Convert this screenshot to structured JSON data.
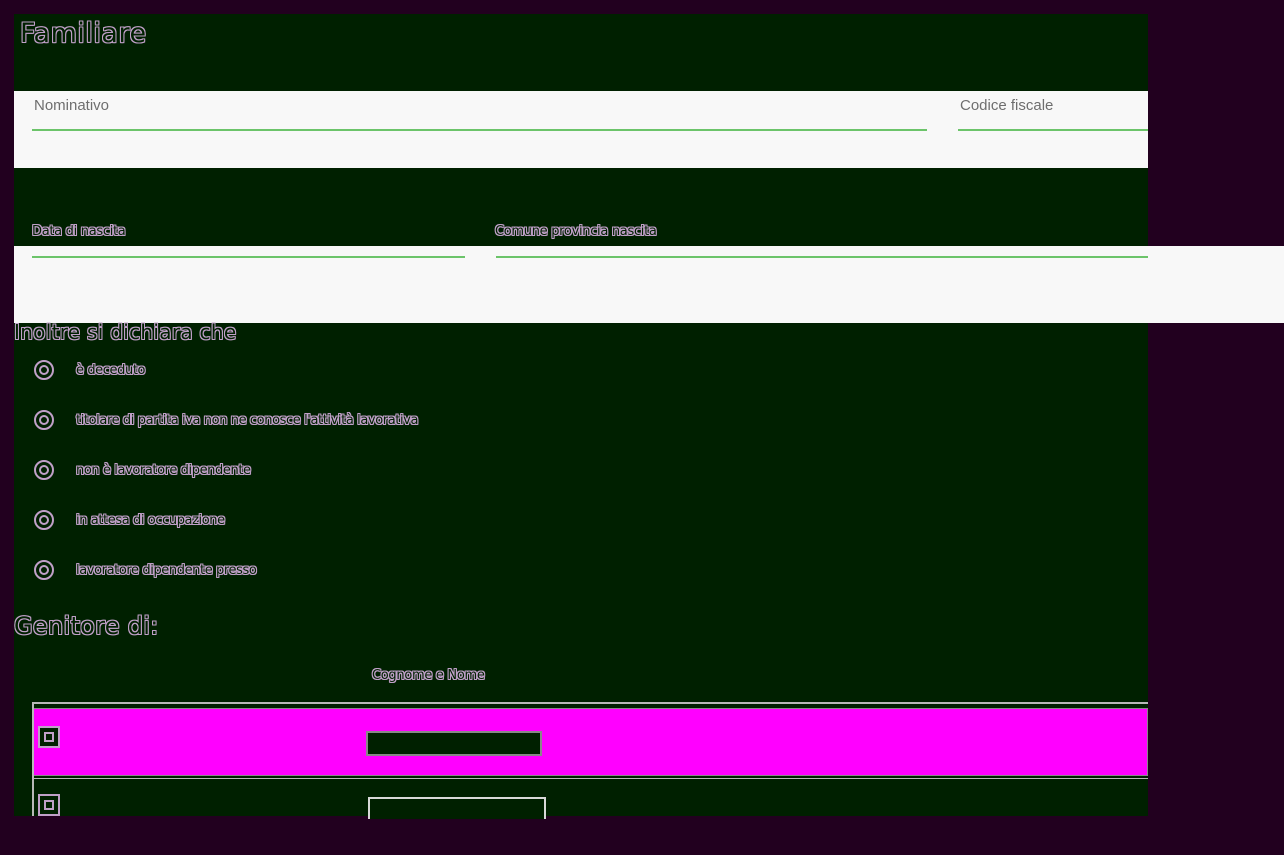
{
  "form": {
    "title": "Familiare",
    "fields": {
      "nominativo_label": "Nominativo",
      "codice_fiscale_label": "Codice fiscale",
      "data_nascita_label": "Data di nascita",
      "comune_nascita_label": "Comune provincia nascita"
    },
    "declaration": {
      "heading": "Inoltre si dichiara che",
      "options": [
        "è deceduto",
        "titolare di partita iva non ne conosce l'attività lavorativa",
        "non è lavoratore dipendente",
        "in attesa di occupazione",
        "lavoratore dipendente presso"
      ]
    },
    "parent": {
      "heading": "Genitore di:",
      "column_header": "Cognome e Nome"
    }
  },
  "colors": {
    "panel_bg": "#002000",
    "page_bg": "#22001f",
    "field_line": "#6cc46a",
    "selected_row": "#ff00ff"
  }
}
